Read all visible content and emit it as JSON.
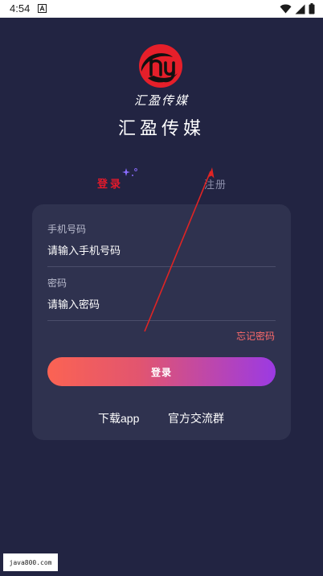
{
  "status_bar": {
    "time": "4:54"
  },
  "brand": {
    "logo_script": "汇盈传媒",
    "title": "汇盈传媒"
  },
  "tabs": {
    "login": "登录",
    "register": "注册"
  },
  "form": {
    "phone_label": "手机号码",
    "phone_placeholder": "请输入手机号码",
    "password_label": "密码",
    "password_placeholder": "请输入密码",
    "forgot_password": "忘记密码",
    "login_button": "登录"
  },
  "links": {
    "download_app": "下载app",
    "official_group": "官方交流群"
  },
  "watermark": "java800.com",
  "colors": {
    "background": "#222442",
    "card": "#2f324f",
    "active_tab": "#e21a2b",
    "forgot_link": "#ff6b6b",
    "button_gradient_start": "#fb6353",
    "button_gradient_end": "#9b3ae3",
    "annotation_arrow": "#e02424"
  }
}
